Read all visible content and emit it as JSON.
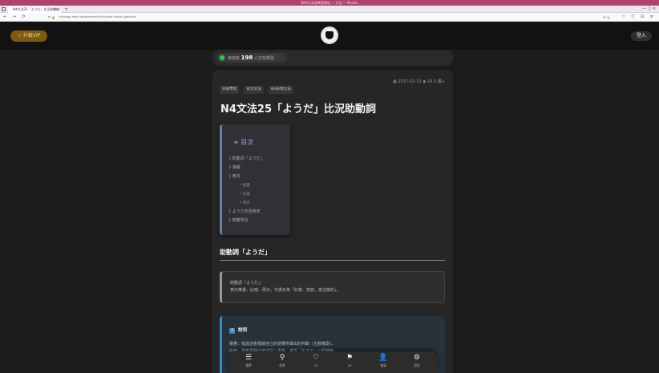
{
  "browser": {
    "os_title": "NHK日本語學習網站 — 文法 — Mozilla",
    "tab_title": "N4文法25「ようだ」比況助動詞",
    "tab_close": "×",
    "new_tab": "+",
    "window_controls": "— ▢ ✕",
    "nav_buttons": "← → ⟳",
    "url_icons": "⛉ 🔒",
    "url": "nihongo-learn.tw/grammar/n4/youda-hikyou-jodoushi",
    "zoom": "⊕ 🔍",
    "toolbar_icons": "☆ ⛉ ⊡ ≡"
  },
  "header": {
    "vip_label": "☆ 升級VIP",
    "login_label": "登入"
  },
  "online": {
    "prefix": "目前有",
    "count": "198",
    "suffix": "人正在學習"
  },
  "article": {
    "tags": [
      "日語學習",
      "日文文法",
      "N4表現文法"
    ],
    "date": "▦ 2017-02-15",
    "views": "◉ 19.3 萬+",
    "title": "N4文法25「ようだ」比況助動詞"
  },
  "toc": {
    "heading": "目次",
    "items": [
      {
        "label": "├ 助動詞「ようだ」",
        "sub": false
      },
      {
        "label": "├ 接續",
        "sub": false
      },
      {
        "label": "├ 用法",
        "sub": false
      },
      {
        "label": "└ 推量",
        "sub": true
      },
      {
        "label": "└ 比喻",
        "sub": true
      },
      {
        "label": "└ 例示",
        "sub": true
      },
      {
        "label": "├ ようだ的活用表",
        "sub": false
      },
      {
        "label": "├ 推薦學習",
        "sub": false
      }
    ]
  },
  "section": {
    "heading": "助動詞「ようだ」"
  },
  "quote": {
    "line1": "助動詞「ようだ」：",
    "line2": "表示推量、比喻、例示。中譯多為「好像、宛如、像這樣的」。"
  },
  "note": {
    "icon": "i",
    "heading": "說明",
    "line1": "推量：指說話者根據自己的感覺所做出的判斷（主觀推測）。",
    "line2": "比喻：將某事物比喻成另一事物，常與「まるで」一起使用。"
  },
  "bottom_nav": [
    {
      "icon": "☰",
      "label": "選單"
    },
    {
      "icon": "⚲",
      "label": "搜尋"
    },
    {
      "icon": "♡",
      "label": "24"
    },
    {
      "icon": "⚑",
      "label": "56"
    },
    {
      "icon": "👤",
      "label": "會員"
    },
    {
      "icon": "⚙",
      "label": "設定"
    }
  ],
  "colors": {
    "vip": "#7c5a14",
    "online_dot": "#39c25b",
    "toc_accent": "#6a7ea8",
    "note_accent": "#3c8bc9"
  }
}
